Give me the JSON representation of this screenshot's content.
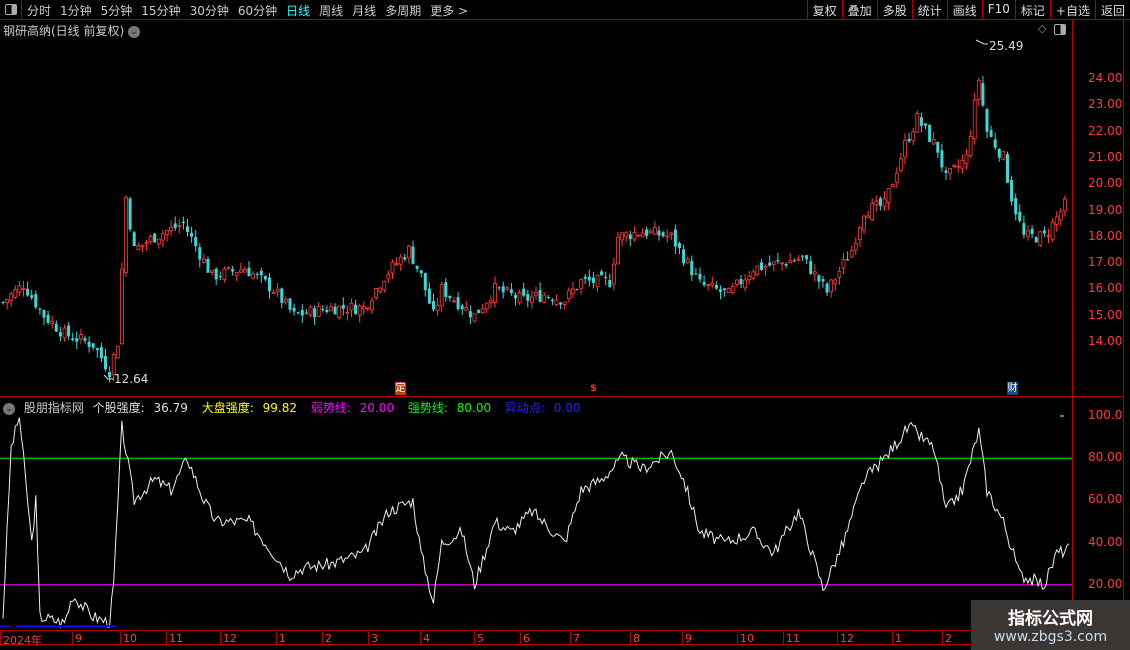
{
  "toolbar": {
    "periods": [
      "分时",
      "1分钟",
      "5分钟",
      "15分钟",
      "30分钟",
      "60分钟",
      "日线",
      "周线",
      "月线",
      "多周期",
      "更多 >"
    ],
    "active": "日线",
    "buttons": [
      "复权",
      "叠加",
      "多股",
      "统计",
      "画线",
      "F10",
      "标记",
      "+自选",
      "返回"
    ]
  },
  "main": {
    "title": "钢研高纳(日线 前复权)",
    "high_label": "25.49",
    "low_label": "12.64",
    "yaxis": [
      "24.00",
      "23.00",
      "22.00",
      "21.00",
      "20.00",
      "19.00",
      "18.00",
      "17.00",
      "16.00",
      "15.00",
      "14.00"
    ],
    "markers": {
      "ding": "定",
      "money": "$",
      "cai": "财"
    }
  },
  "osc": {
    "name": "股朋指标网",
    "stock_label": "个股强度:",
    "stock_value": "36.79",
    "market_label": "大盘强度:",
    "market_value": "99.82",
    "weak_label": "弱势线:",
    "weak_value": "20.00",
    "strong_label": "强势线:",
    "strong_value": "80.00",
    "alert_label": "异动点:",
    "alert_value": "0.00",
    "yaxis": [
      "100.0",
      "80.00",
      "60.00",
      "40.00",
      "20.00"
    ]
  },
  "xaxis": [
    "2024年",
    "9",
    "10",
    "11",
    "12",
    "1",
    "2",
    "3",
    "4",
    "5",
    "6",
    "7",
    "8",
    "9",
    "10",
    "11",
    "12",
    "1",
    "2"
  ],
  "watermark": {
    "title": "指标公式网",
    "url": "www.zbgs3.com"
  },
  "colors": {
    "up": "#ff3b3b",
    "down": "#3fd6d6",
    "weak": "#ff00ff",
    "strong": "#00ff00",
    "alert": "#0000ff"
  },
  "chart_data": [
    {
      "type": "candlestick",
      "title": "钢研高纳 日线",
      "ylim": [
        12.5,
        25.6
      ],
      "x_unit": "bar index",
      "close_path": [
        [
          0,
          15.5
        ],
        [
          5,
          16.2
        ],
        [
          10,
          15
        ],
        [
          15,
          14.3
        ],
        [
          22,
          13.9
        ],
        [
          26,
          12.9
        ],
        [
          28,
          14
        ],
        [
          30,
          19.5
        ],
        [
          32,
          17.5
        ],
        [
          37,
          18
        ],
        [
          44,
          18.5
        ],
        [
          51,
          16.5
        ],
        [
          59,
          16.8
        ],
        [
          66,
          16
        ],
        [
          71,
          15
        ],
        [
          80,
          15.3
        ],
        [
          88,
          15.3
        ],
        [
          93,
          16.5
        ],
        [
          99,
          17.5
        ],
        [
          102,
          16.5
        ],
        [
          105,
          15
        ],
        [
          107,
          16
        ],
        [
          115,
          15
        ],
        [
          120,
          16
        ],
        [
          127,
          15.6
        ],
        [
          132,
          15.8
        ],
        [
          137,
          15.6
        ],
        [
          141,
          16.3
        ],
        [
          148,
          16.3
        ],
        [
          150,
          18
        ],
        [
          156,
          18.2
        ],
        [
          163,
          18
        ],
        [
          170,
          16.2
        ],
        [
          177,
          15.8
        ],
        [
          183,
          16.8
        ],
        [
          190,
          17
        ],
        [
          195,
          17.2
        ],
        [
          201,
          15.9
        ],
        [
          207,
          17.5
        ],
        [
          210,
          19
        ],
        [
          215,
          19.2
        ],
        [
          220,
          21.5
        ],
        [
          223,
          22.5
        ],
        [
          228,
          21.3
        ],
        [
          230,
          20.2
        ],
        [
          235,
          21
        ],
        [
          238,
          24
        ],
        [
          240,
          22
        ],
        [
          244,
          21
        ],
        [
          246,
          19.5
        ],
        [
          249,
          18
        ],
        [
          254,
          18
        ],
        [
          259,
          19.2
        ]
      ]
    },
    {
      "type": "line",
      "title": "个股强度",
      "ylim": [
        0,
        105
      ],
      "hlines": [
        20,
        80
      ],
      "x_unit": "bar index",
      "points": [
        [
          0,
          5
        ],
        [
          2,
          85
        ],
        [
          4,
          100
        ],
        [
          5,
          80
        ],
        [
          7,
          40
        ],
        [
          8,
          60
        ],
        [
          9,
          5
        ],
        [
          15,
          2
        ],
        [
          17,
          15
        ],
        [
          22,
          5
        ],
        [
          26,
          2
        ],
        [
          27,
          20
        ],
        [
          29,
          95
        ],
        [
          32,
          60
        ],
        [
          37,
          70
        ],
        [
          41,
          65
        ],
        [
          45,
          80
        ],
        [
          49,
          60
        ],
        [
          52,
          50
        ],
        [
          60,
          50
        ],
        [
          66,
          35
        ],
        [
          70,
          25
        ],
        [
          73,
          28
        ],
        [
          80,
          30
        ],
        [
          88,
          35
        ],
        [
          94,
          55
        ],
        [
          100,
          60
        ],
        [
          102,
          35
        ],
        [
          105,
          12
        ],
        [
          107,
          40
        ],
        [
          112,
          45
        ],
        [
          115,
          20
        ],
        [
          120,
          50
        ],
        [
          124,
          45
        ],
        [
          129,
          55
        ],
        [
          137,
          40
        ],
        [
          141,
          65
        ],
        [
          146,
          70
        ],
        [
          151,
          80
        ],
        [
          156,
          75
        ],
        [
          163,
          83
        ],
        [
          166,
          70
        ],
        [
          170,
          45
        ],
        [
          176,
          40
        ],
        [
          183,
          45
        ],
        [
          188,
          35
        ],
        [
          194,
          55
        ],
        [
          199,
          25
        ],
        [
          200,
          18
        ],
        [
          205,
          40
        ],
        [
          210,
          70
        ],
        [
          215,
          80
        ],
        [
          221,
          95
        ],
        [
          227,
          85
        ],
        [
          230,
          55
        ],
        [
          234,
          65
        ],
        [
          238,
          93
        ],
        [
          240,
          65
        ],
        [
          244,
          50
        ],
        [
          248,
          25
        ],
        [
          254,
          20
        ],
        [
          257,
          35
        ],
        [
          260,
          37
        ]
      ]
    }
  ]
}
